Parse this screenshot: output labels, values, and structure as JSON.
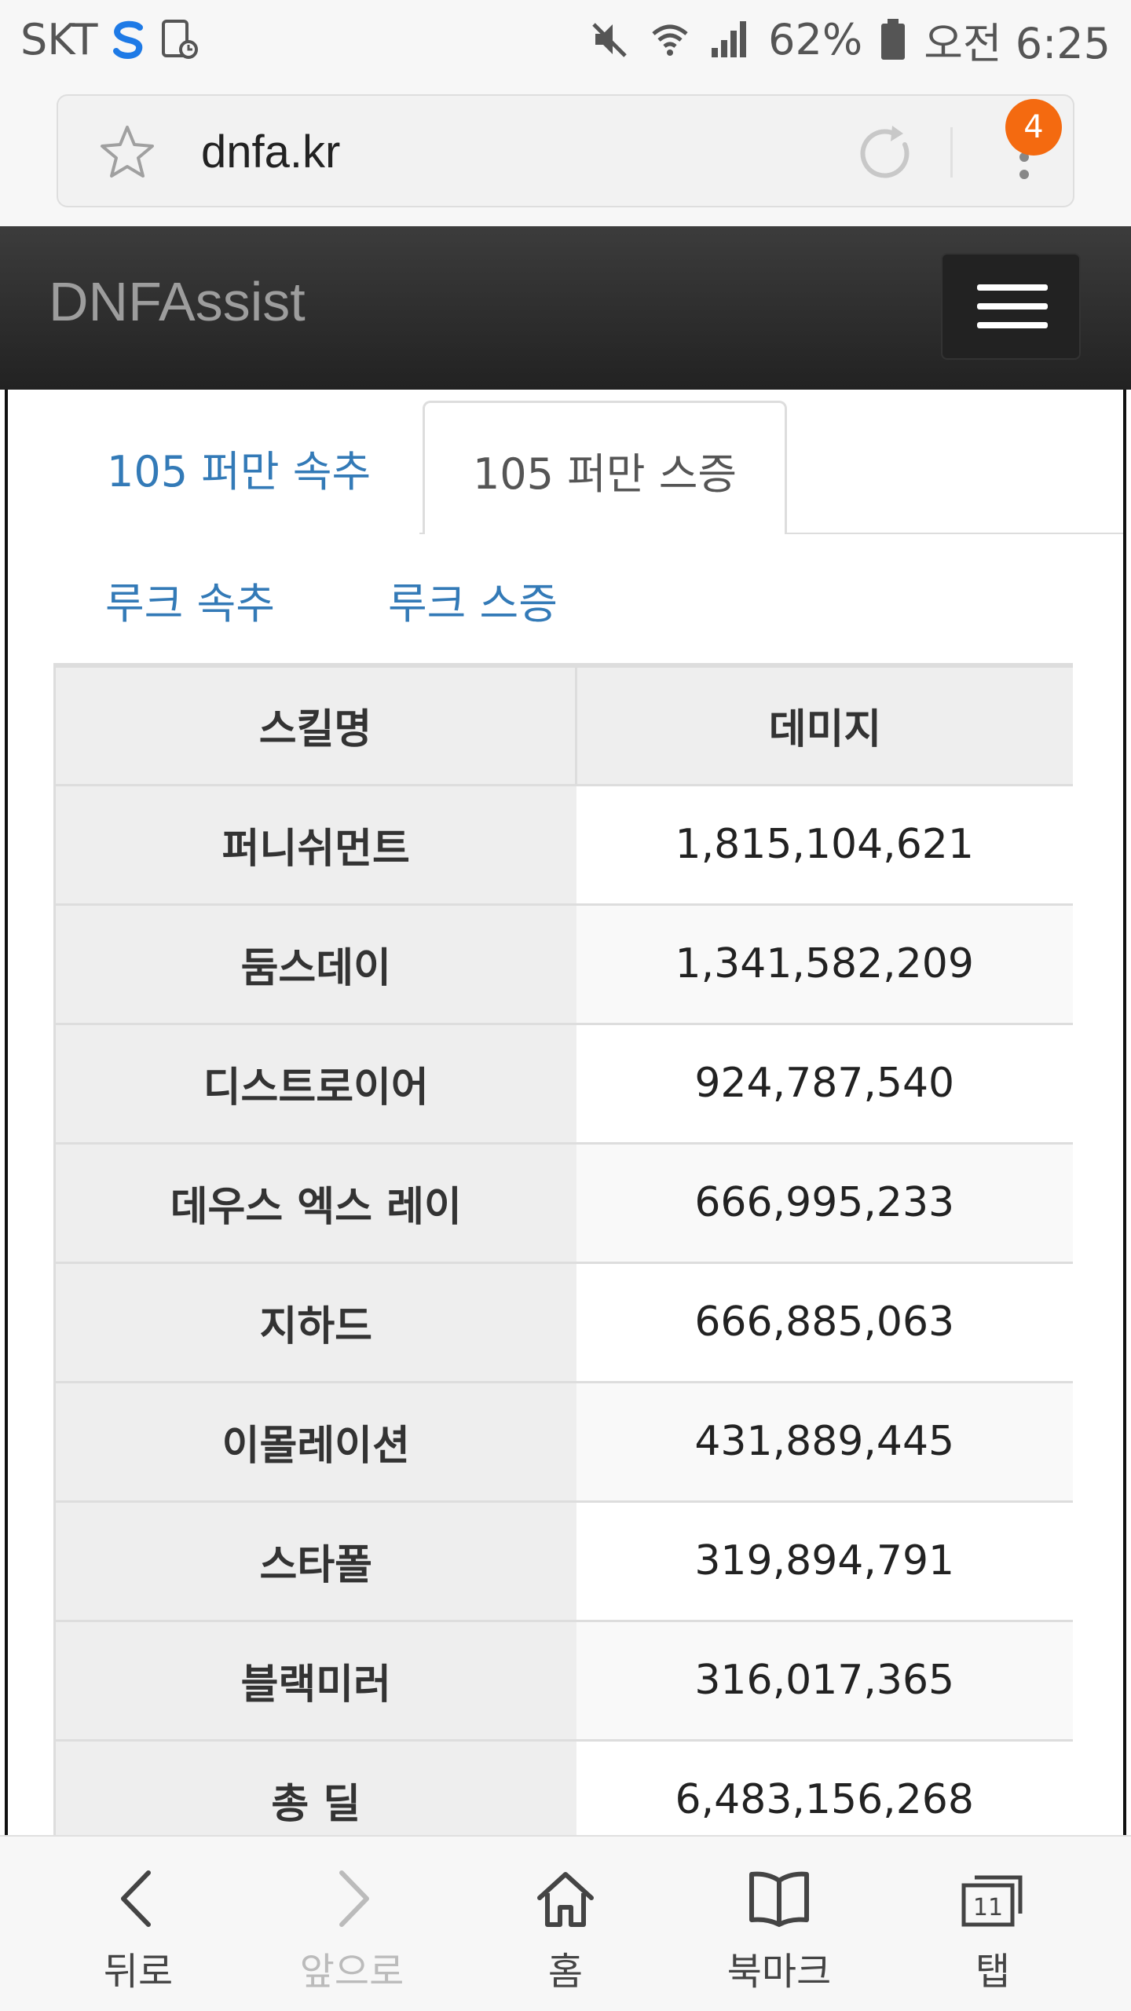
{
  "status_bar": {
    "carrier": "SKT",
    "battery": "62%",
    "time": "오전 6:25"
  },
  "browser": {
    "url": "dnfa.kr",
    "tab_badge": "4"
  },
  "navbar": {
    "brand": "DNFAssist"
  },
  "tabs": [
    {
      "label": "105 퍼만 속추",
      "active": false
    },
    {
      "label": "105 퍼만 스증",
      "active": true
    }
  ],
  "subtabs": [
    {
      "label": "루크 속추"
    },
    {
      "label": "루크 스증"
    }
  ],
  "table": {
    "headers": [
      "스킬명",
      "데미지"
    ],
    "rows": [
      {
        "skill": "퍼니쉬먼트",
        "damage": "1,815,104,621"
      },
      {
        "skill": "둠스데이",
        "damage": "1,341,582,209"
      },
      {
        "skill": "디스트로이어",
        "damage": "924,787,540"
      },
      {
        "skill": "데우스 엑스 레이",
        "damage": "666,995,233"
      },
      {
        "skill": "지하드",
        "damage": "666,885,063"
      },
      {
        "skill": "이몰레이션",
        "damage": "431,889,445"
      },
      {
        "skill": "스타폴",
        "damage": "319,894,791"
      },
      {
        "skill": "블랙미러",
        "damage": "316,017,365"
      },
      {
        "skill": "총 딜",
        "damage": "6,483,156,268"
      }
    ]
  },
  "bottom_bar": {
    "back": "뒤로",
    "forward": "앞으로",
    "home": "홈",
    "bookmarks": "북마크",
    "tabs": "탭",
    "tab_count": "11"
  },
  "colors": {
    "link": "#337ab7",
    "navbar": "#222222",
    "badge": "#f46a10"
  }
}
